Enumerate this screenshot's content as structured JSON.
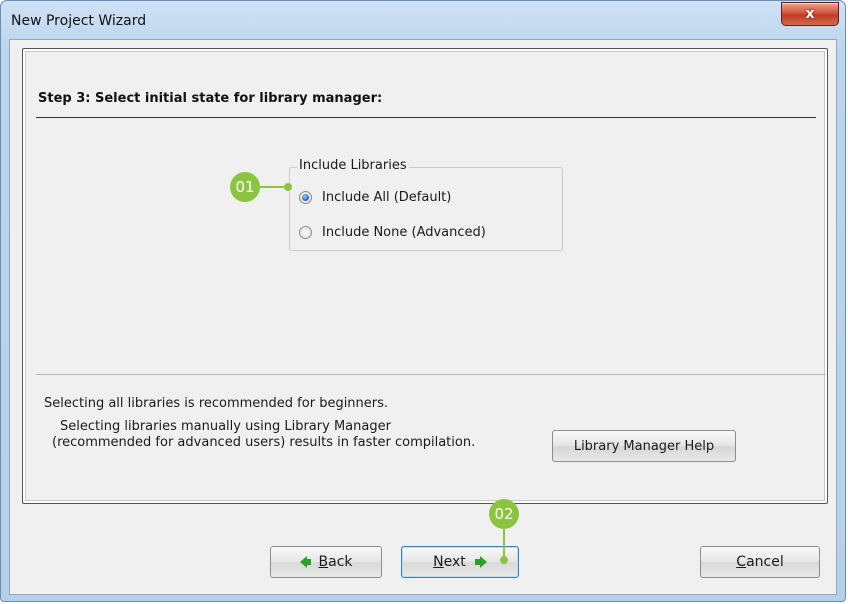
{
  "window": {
    "title": "New Project Wizard",
    "close_symbol": "x"
  },
  "step_title": "Step 3: Select initial state for library manager:",
  "include_libraries": {
    "legend": "Include Libraries",
    "options": [
      {
        "label": "Include All (Default)",
        "checked": true
      },
      {
        "label": "Include None (Advanced)",
        "checked": false
      }
    ]
  },
  "info": {
    "line1": "Selecting all libraries is recommended for beginners.",
    "line2": "Selecting libraries manually using Library Manager",
    "line3": "(recommended for advanced users) results in faster compilation."
  },
  "help_button": "Library Manager Help",
  "buttons": {
    "back": "Back",
    "next": "Next",
    "cancel": "Cancel"
  },
  "callouts": {
    "first": "01",
    "second": "02"
  },
  "colors": {
    "callout": "#8bc53f",
    "arrow": "#2aa12a",
    "close": "#c23a24"
  }
}
